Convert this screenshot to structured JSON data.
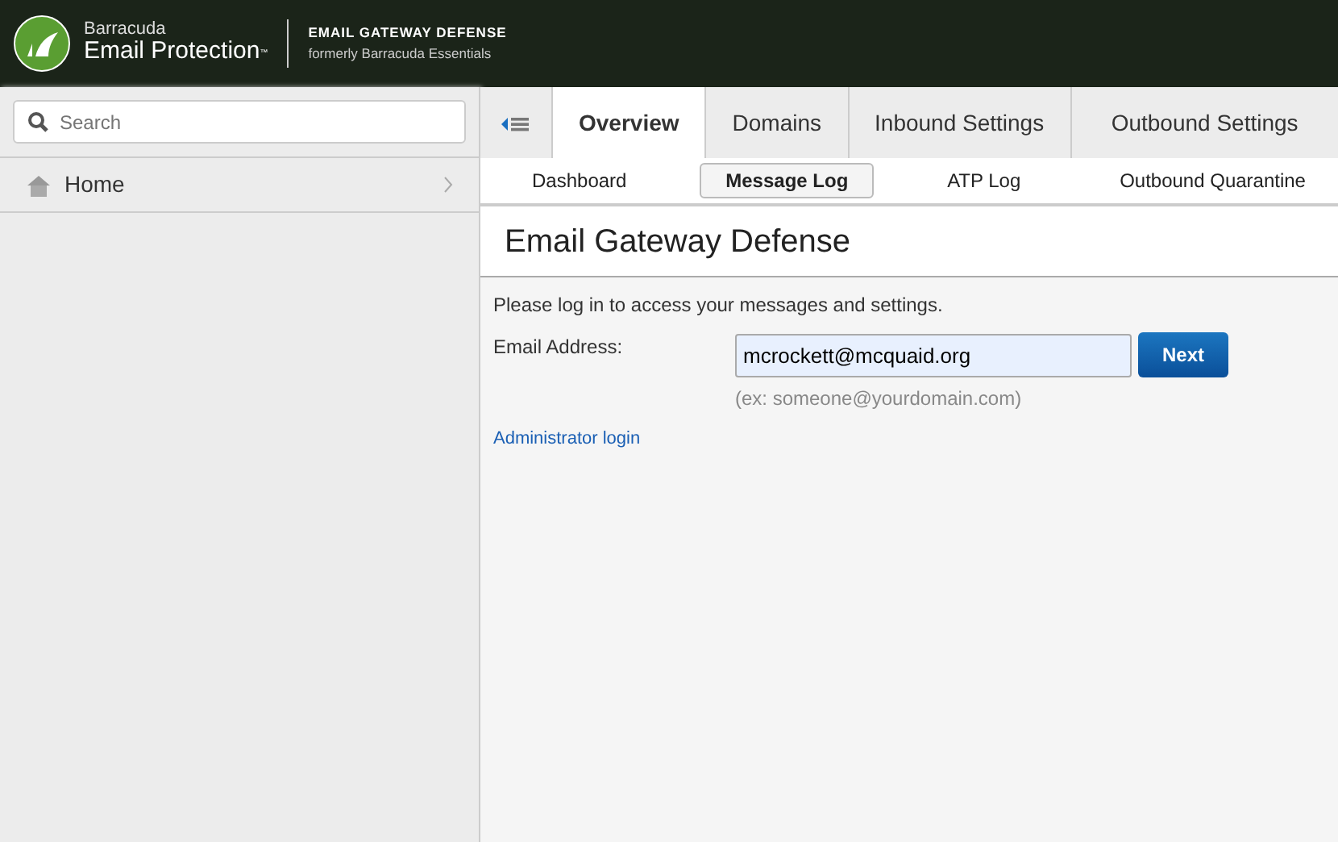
{
  "header": {
    "brand_small": "Barracuda",
    "brand_large": "Email Protection$^{™}$",
    "product": "EMAIL GATEWAY DEFENSE",
    "subtitle": "formerly Barracuda Essentials"
  },
  "sidebar": {
    "search": {
      "placeholder": "Search"
    },
    "items": [
      {
        "label": "Home",
        "selected": false
      }
    ]
  },
  "tabs": [
    {
      "label": "Overview",
      "selected": true
    },
    {
      "label": "Domains",
      "selected": false
    },
    {
      "label": "Inbound Settings",
      "selected": false
    },
    {
      "label": "Outbound Settings",
      "selected": false
    }
  ],
  "subtabs": [
    {
      "label": "Dashboard",
      "selected": false
    },
    {
      "label": "Message Log",
      "selected": true
    },
    {
      "label": "ATP Log",
      "selected": false
    },
    {
      "label": "Outbound Quarantine",
      "selected": false
    }
  ],
  "page_title": "Email Gateway Defense",
  "form": {
    "intro": "Please log in to access your messages and settings.",
    "email_label": "Email Address:",
    "email_value": "mcrockett@mcquaid.org",
    "hint": "(ex: someone@yourdomain.com)",
    "submit": "Next",
    "admin_link": "Administrator login"
  }
}
